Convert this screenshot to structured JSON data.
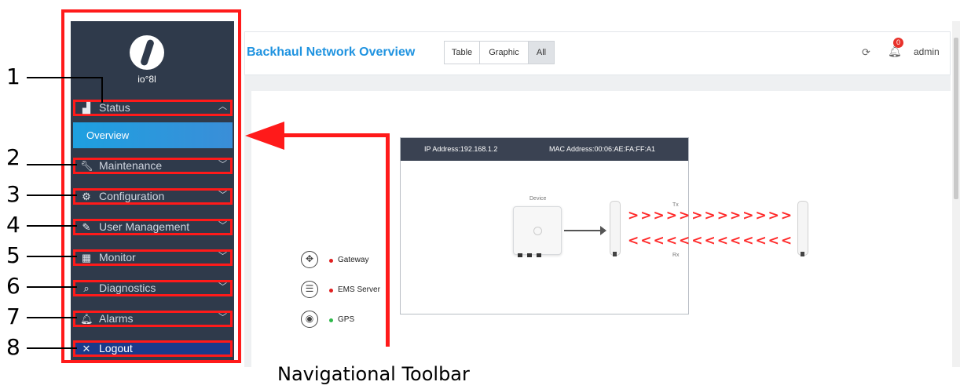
{
  "callouts": [
    "1",
    "2",
    "3",
    "4",
    "5",
    "6",
    "7",
    "8"
  ],
  "caption": "Navigational Toolbar",
  "sidebar": {
    "brand": "io°8l",
    "items": [
      {
        "label": "Status",
        "icon": "signal-icon",
        "chevron": "^"
      },
      {
        "label": "Maintenance",
        "icon": "wrench-icon",
        "chevron": "v"
      },
      {
        "label": "Configuration",
        "icon": "gear-icon",
        "chevron": "v"
      },
      {
        "label": "User Management",
        "icon": "pencil-icon",
        "chevron": "v"
      },
      {
        "label": "Monitor",
        "icon": "grid-icon",
        "chevron": "v"
      },
      {
        "label": "Diagnostics",
        "icon": "search-icon",
        "chevron": "v"
      },
      {
        "label": "Alarms",
        "icon": "bell-icon",
        "chevron": "v"
      },
      {
        "label": "Logout",
        "icon": "close-icon"
      }
    ],
    "active_sub": "Overview"
  },
  "header": {
    "title": "Backhaul Network Overview",
    "tabs": [
      "Table",
      "Graphic",
      "All"
    ],
    "active_tab": "All",
    "notification_count": "0",
    "user": "admin"
  },
  "panel": {
    "ip": "IP Address:192.168.1.2",
    "mac": "MAC Address:00:06:AE:FA:FF:A1",
    "device_label": "Device",
    "tx": "Tx",
    "rx": "Rx"
  },
  "legend": [
    {
      "label": "Gateway",
      "icon": "move-icon",
      "status_color": "#e02020"
    },
    {
      "label": "EMS Server",
      "icon": "server-icon",
      "status_color": "#e02020"
    },
    {
      "label": "GPS",
      "icon": "location-icon",
      "status_color": "#2eb84a"
    }
  ],
  "colors": {
    "accent": "#1f93e0",
    "highlight": "#ff1a1a",
    "sidebar": "#2f3a4b"
  }
}
